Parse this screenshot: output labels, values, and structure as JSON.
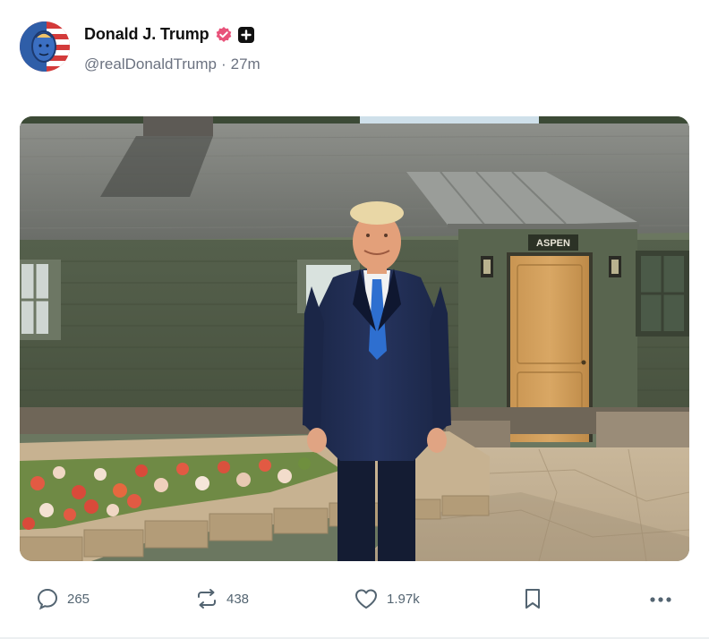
{
  "post": {
    "display_name": "Donald J. Trump",
    "handle": "@realDonaldTrump",
    "separator": "·",
    "time": "27m",
    "sign_text": "ASPEN"
  },
  "actions": {
    "replies": "265",
    "reposts": "438",
    "likes": "1.97k"
  },
  "colors": {
    "verified_badge": "#e8527a",
    "icon_gray": "#536471",
    "text_primary": "#111111",
    "text_secondary": "#6b7280"
  },
  "icons": [
    "reply-icon",
    "repost-icon",
    "heart-icon",
    "bookmark-icon",
    "more-icon",
    "verified-icon",
    "plus-icon"
  ]
}
